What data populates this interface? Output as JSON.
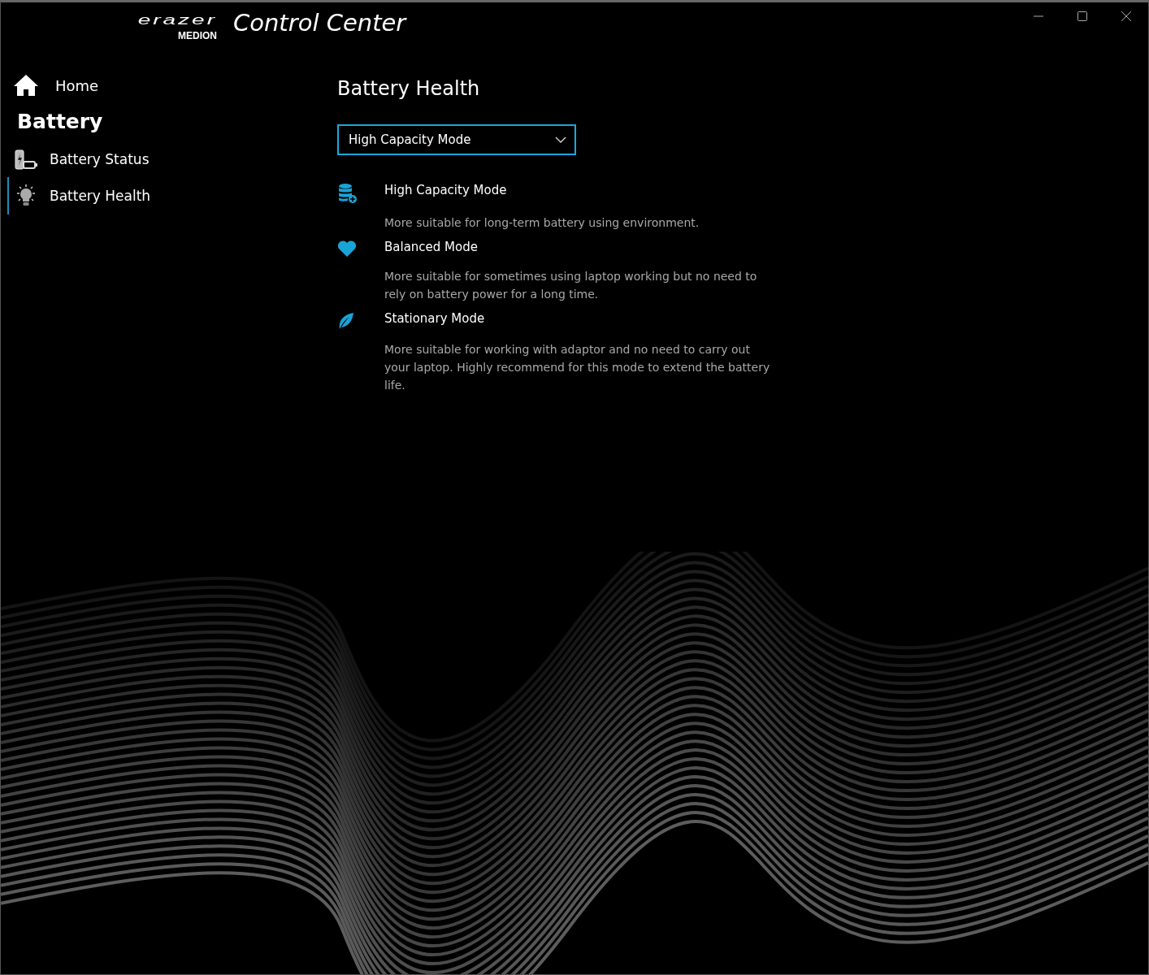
{
  "window": {
    "logo_word": "erazer",
    "logo_brand": "MEDION",
    "title": "Control Center"
  },
  "sidebar": {
    "home": {
      "label": "Home"
    },
    "section": "Battery",
    "items": [
      {
        "label": "Battery Status",
        "kind": "status",
        "selected": false
      },
      {
        "label": "Battery Health",
        "kind": "health",
        "selected": true
      }
    ]
  },
  "page": {
    "title": "Battery Health",
    "dropdown": {
      "value": "High Capacity Mode"
    },
    "modes": [
      {
        "kind": "capacity",
        "name": "High Capacity Mode",
        "description": "More suitable for long-term battery using environment."
      },
      {
        "kind": "balanced",
        "name": "Balanced Mode",
        "description": "More suitable for sometimes using laptop working but no need to rely on battery power for a long time."
      },
      {
        "kind": "stationary",
        "name": "Stationary Mode",
        "description": "More suitable for working with adaptor and no need to carry out your laptop. Highly recommend for this mode to extend the battery life."
      }
    ]
  }
}
